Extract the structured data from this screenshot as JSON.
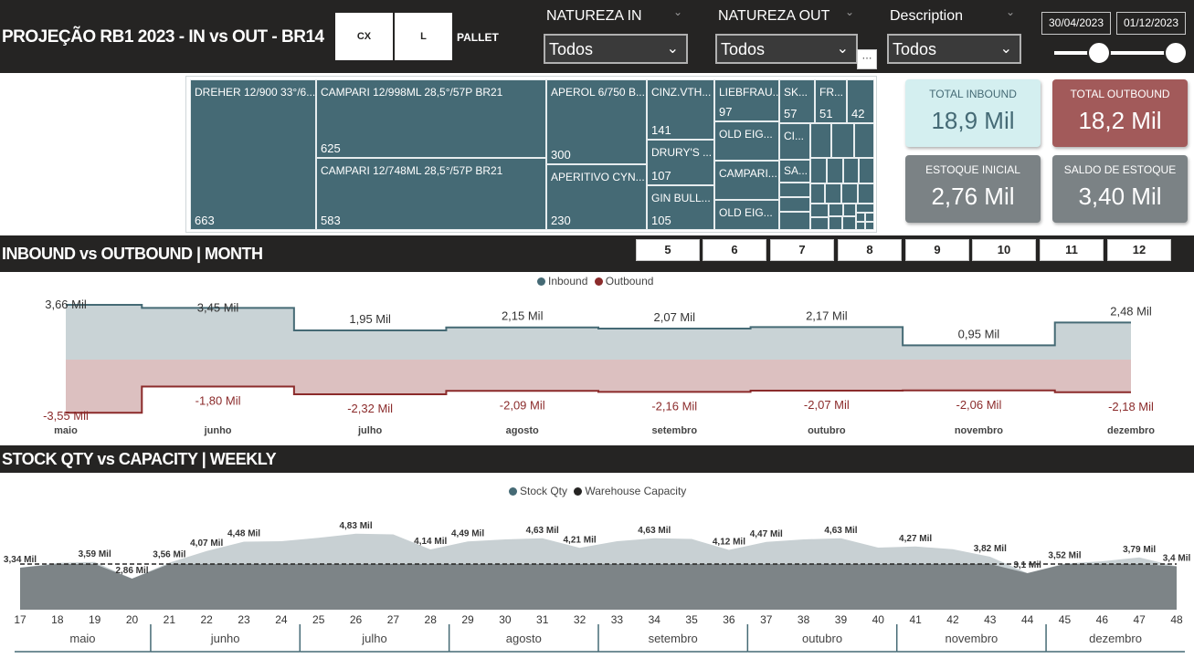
{
  "header": {
    "title": "PROJEÇÃO RB1 2023 - IN vs OUT - BR14",
    "units": [
      "CX",
      "L",
      "PALLET"
    ],
    "slicers": [
      {
        "label": "NATUREZA IN",
        "value": "Todos"
      },
      {
        "label": "NATUREZA OUT",
        "value": "Todos"
      },
      {
        "label": "Description",
        "value": "Todos"
      }
    ],
    "date_start": "30/04/2023",
    "date_end": "01/12/2023"
  },
  "treemap": [
    {
      "label": "DREHER 12/900 33°/6...",
      "value": "663"
    },
    {
      "label": "CAMPARI 12/998ML 28,5°/57P BR21",
      "value": "625"
    },
    {
      "label": "CAMPARI 12/748ML 28,5°/57P BR21",
      "value": "583"
    },
    {
      "label": "APEROL 6/750 B...",
      "value": "300"
    },
    {
      "label": "APERITIVO CYN...",
      "value": "230"
    },
    {
      "label": "CINZ.VTH...",
      "value": "141"
    },
    {
      "label": "DRURY'S ...",
      "value": "107"
    },
    {
      "label": "GIN BULL...",
      "value": "105"
    },
    {
      "label": "LIEBFRAU...",
      "value": "97"
    },
    {
      "label": "OLD EIG...",
      "value": ""
    },
    {
      "label": "CAMPARI...",
      "value": ""
    },
    {
      "label": "OLD EIG...",
      "value": ""
    },
    {
      "label": "SK...",
      "value": "57"
    },
    {
      "label": "FR...",
      "value": "51"
    },
    {
      "label": "",
      "value": "42"
    },
    {
      "label": "CI...",
      "value": ""
    },
    {
      "label": "SA...",
      "value": ""
    }
  ],
  "kpis": [
    {
      "label": "TOTAL INBOUND",
      "value": "18,9 Mil",
      "bg": "#d4eff0",
      "fg": "#456a75"
    },
    {
      "label": "TOTAL OUTBOUND",
      "value": "18,2 Mil",
      "bg": "#a25a5a",
      "fg": "#ffffff"
    },
    {
      "label": "ESTOQUE INICIAL",
      "value": "2,76 Mil",
      "bg": "#7b8285",
      "fg": "#ffffff"
    },
    {
      "label": "SALDO DE ESTOQUE",
      "value": "3,40 Mil",
      "bg": "#7b8285",
      "fg": "#ffffff"
    }
  ],
  "section1": {
    "title": "INBOUND vs OUTBOUND | MONTH",
    "month_buttons": [
      "5",
      "6",
      "7",
      "8",
      "9",
      "10",
      "11",
      "12"
    ]
  },
  "section2": {
    "title": "STOCK QTY vs CAPACITY | WEEKLY"
  },
  "colors": {
    "dark": "#252423",
    "inbound": "#456a75",
    "outbound": "#8b2b2b",
    "stock": "#456a75",
    "capacity": "#252423"
  },
  "chart_data": [
    {
      "type": "area",
      "legend": [
        "Inbound",
        "Outbound"
      ],
      "legend_position": "top-center",
      "categories": [
        "maio",
        "junho",
        "julho",
        "agosto",
        "setembro",
        "outubro",
        "novembro",
        "dezembro"
      ],
      "series": [
        {
          "name": "Inbound",
          "values": [
            3.66,
            3.45,
            1.95,
            2.15,
            2.07,
            2.17,
            0.95,
            2.48
          ],
          "labels": [
            "3,66 Mil",
            "3,45 Mil",
            "1,95 Mil",
            "2,15 Mil",
            "2,07 Mil",
            "2,17 Mil",
            "0,95 Mil",
            "2,48 Mil"
          ]
        },
        {
          "name": "Outbound",
          "values": [
            -3.55,
            -1.8,
            -2.32,
            -2.09,
            -2.16,
            -2.07,
            -2.06,
            -2.18
          ],
          "labels": [
            "-3,55 Mil",
            "-1,80 Mil",
            "-2,32 Mil",
            "-2,09 Mil",
            "-2,16 Mil",
            "-2,07 Mil",
            "-2,06 Mil",
            "-2,18 Mil"
          ]
        }
      ]
    },
    {
      "type": "area",
      "legend": [
        "Stock Qty",
        "Warehouse Capacity"
      ],
      "legend_position": "top-center",
      "x": [
        17,
        18,
        19,
        20,
        21,
        22,
        23,
        24,
        25,
        26,
        27,
        28,
        29,
        30,
        31,
        32,
        33,
        34,
        35,
        36,
        37,
        38,
        39,
        40,
        41,
        42,
        43,
        44,
        45,
        46,
        47,
        48
      ],
      "months": [
        {
          "label": "maio",
          "weeks": [
            17,
            20
          ]
        },
        {
          "label": "junho",
          "weeks": [
            21,
            24
          ]
        },
        {
          "label": "julho",
          "weeks": [
            25,
            28
          ]
        },
        {
          "label": "agosto",
          "weeks": [
            29,
            32
          ]
        },
        {
          "label": "setembro",
          "weeks": [
            33,
            36
          ]
        },
        {
          "label": "outubro",
          "weeks": [
            37,
            40
          ]
        },
        {
          "label": "novembro",
          "weeks": [
            41,
            44
          ]
        },
        {
          "label": "dezembro",
          "weeks": [
            45,
            48
          ]
        }
      ],
      "series": [
        {
          "name": "Stock Qty",
          "values": [
            3.34,
            3.55,
            3.59,
            2.86,
            3.56,
            4.07,
            4.48,
            4.5,
            4.65,
            4.83,
            4.8,
            4.14,
            4.49,
            4.58,
            4.63,
            4.21,
            4.5,
            4.63,
            4.6,
            4.12,
            4.47,
            4.58,
            4.63,
            4.22,
            4.27,
            4.15,
            3.82,
            3.1,
            3.52,
            3.62,
            3.79,
            3.4
          ]
        },
        {
          "name": "Warehouse Capacity",
          "values": [
            3.5
          ]
        }
      ],
      "point_labels": [
        {
          "week": 17,
          "text": "3,34 Mil"
        },
        {
          "week": 19,
          "text": "3,59 Mil"
        },
        {
          "week": 20,
          "text": "2,86 Mil"
        },
        {
          "week": 21,
          "text": "3,56 Mil"
        },
        {
          "week": 22,
          "text": "4,07 Mil"
        },
        {
          "week": 23,
          "text": "4,48 Mil"
        },
        {
          "week": 26,
          "text": "4,83 Mil"
        },
        {
          "week": 28,
          "text": "4,14 Mil"
        },
        {
          "week": 29,
          "text": "4,49 Mil"
        },
        {
          "week": 31,
          "text": "4,63 Mil"
        },
        {
          "week": 32,
          "text": "4,21 Mil"
        },
        {
          "week": 34,
          "text": "4,63 Mil"
        },
        {
          "week": 36,
          "text": "4,12 Mil"
        },
        {
          "week": 37,
          "text": "4,47 Mil"
        },
        {
          "week": 39,
          "text": "4,63 Mil"
        },
        {
          "week": 41,
          "text": "4,27 Mil"
        },
        {
          "week": 43,
          "text": "3,82 Mil"
        },
        {
          "week": 44,
          "text": "3,1 Mil"
        },
        {
          "week": 45,
          "text": "3,52 Mil"
        },
        {
          "week": 47,
          "text": "3,79 Mil"
        },
        {
          "week": 48,
          "text": "3,4 Mil"
        }
      ]
    }
  ]
}
